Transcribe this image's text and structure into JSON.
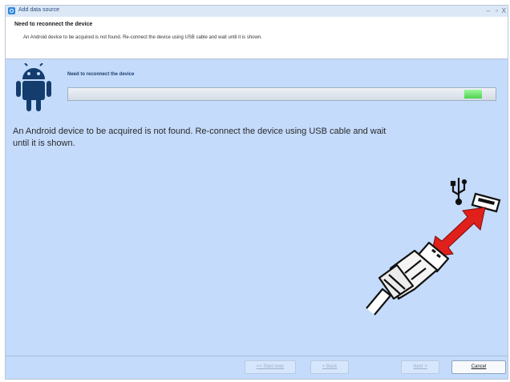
{
  "window": {
    "title": "Add data source"
  },
  "header": {
    "title": "Need to reconnect the device",
    "description": "An Android device to be acquired is not found. Re-connect the device using USB cable and wait until it is shown."
  },
  "status": {
    "label": "Need to reconnect the device"
  },
  "message": "An Android device to be acquired is not found. Re-connect the device using USB cable and wait until it is shown.",
  "buttons": {
    "start_over": "<< Start over",
    "back": "< Back",
    "next": "Next >",
    "cancel": "Cancel"
  },
  "icons": [
    "app-icon",
    "android-icon",
    "usb-symbol-icon",
    "usb-port-icon",
    "connect-arrow-icon",
    "usb-plug-icon"
  ],
  "colors": {
    "background": "#c4dbfb",
    "progress": "#5dd65d",
    "arrow": "#e0201b"
  }
}
